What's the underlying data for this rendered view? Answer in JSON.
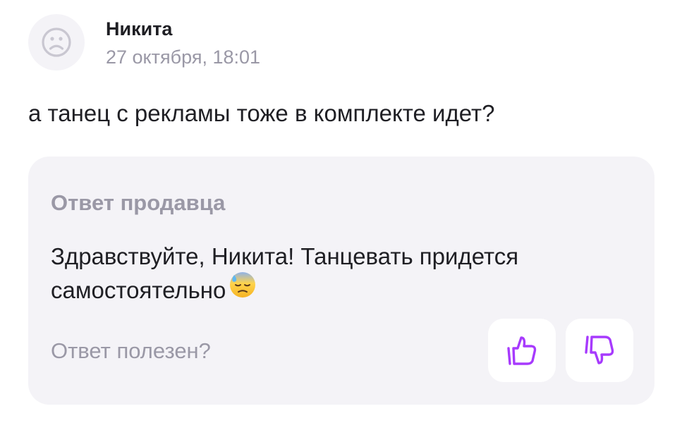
{
  "review": {
    "author_name": "Никита",
    "date": "27 октября, 18:01",
    "avatar_icon": "sad-face-icon",
    "text": "а танец с рекламы тоже в комплекте идет?"
  },
  "seller_reply": {
    "title": "Ответ продавца",
    "text": "Здравствуйте, Никита! Танцевать придется самостоятельно",
    "emoji_icon": "downcast-face-with-sweat-emoji"
  },
  "feedback": {
    "question": "Ответ полезен?",
    "like_icon": "thumbs-up-icon",
    "dislike_icon": "thumbs-down-icon",
    "accent_color": "#a73afd"
  },
  "colors": {
    "card_background": "#f4f3f7",
    "muted_text": "#9a98a6",
    "primary_text": "#1f1f24"
  }
}
